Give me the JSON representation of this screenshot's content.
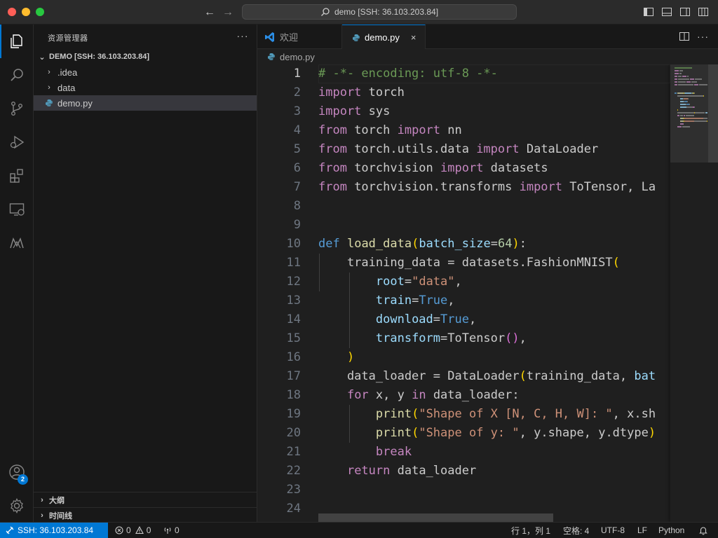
{
  "window": {
    "title": "demo [SSH: 36.103.203.84]"
  },
  "sidebar": {
    "title": "资源管理器",
    "more": "···",
    "root": "DEMO [SSH: 36.103.203.84]",
    "items": [
      {
        "label": ".idea",
        "type": "folder"
      },
      {
        "label": "data",
        "type": "folder"
      },
      {
        "label": "demo.py",
        "type": "file",
        "selected": true
      }
    ],
    "outline_label": "大纲",
    "timeline_label": "时间线"
  },
  "activity": {
    "accounts_badge": "2"
  },
  "tabs": [
    {
      "label": "欢迎",
      "active": false
    },
    {
      "label": "demo.py",
      "active": true,
      "close": "×"
    }
  ],
  "breadcrumb": {
    "file": "demo.py"
  },
  "editor": {
    "line_numbers": [
      "1",
      "2",
      "3",
      "4",
      "5",
      "6",
      "7",
      "8",
      "9",
      "10",
      "11",
      "12",
      "13",
      "14",
      "15",
      "16",
      "17",
      "18",
      "19",
      "20",
      "21",
      "22",
      "23",
      "24"
    ],
    "current_line": 1,
    "lines": [
      [
        [
          "c-comment",
          "# -*- encoding: utf-8 -*-"
        ]
      ],
      [
        [
          "c-kw",
          "import"
        ],
        [
          "c-plain",
          " torch"
        ]
      ],
      [
        [
          "c-kw",
          "import"
        ],
        [
          "c-plain",
          " sys"
        ]
      ],
      [
        [
          "c-kw",
          "from"
        ],
        [
          "c-plain",
          " torch "
        ],
        [
          "c-kw",
          "import"
        ],
        [
          "c-plain",
          " nn"
        ]
      ],
      [
        [
          "c-kw",
          "from"
        ],
        [
          "c-plain",
          " torch.utils.data "
        ],
        [
          "c-kw",
          "import"
        ],
        [
          "c-plain",
          " DataLoader"
        ]
      ],
      [
        [
          "c-kw",
          "from"
        ],
        [
          "c-plain",
          " torchvision "
        ],
        [
          "c-kw",
          "import"
        ],
        [
          "c-plain",
          " datasets"
        ]
      ],
      [
        [
          "c-kw",
          "from"
        ],
        [
          "c-plain",
          " torchvision.transforms "
        ],
        [
          "c-kw",
          "import"
        ],
        [
          "c-plain",
          " ToTensor, La"
        ]
      ],
      [],
      [],
      [
        [
          "c-def",
          "def"
        ],
        [
          "c-plain",
          " "
        ],
        [
          "c-fn",
          "load_data"
        ],
        [
          "c-b1",
          "("
        ],
        [
          "c-param",
          "batch_size"
        ],
        [
          "c-plain",
          "="
        ],
        [
          "c-num",
          "64"
        ],
        [
          "c-b1",
          ")"
        ],
        [
          "c-plain",
          ":"
        ]
      ],
      [
        [
          "c-plain",
          "    training_data = datasets.FashionMNIST"
        ],
        [
          "c-b1",
          "("
        ]
      ],
      [
        [
          "c-plain",
          "        "
        ],
        [
          "c-param",
          "root"
        ],
        [
          "c-plain",
          "="
        ],
        [
          "c-str",
          "\"data\""
        ],
        [
          "c-plain",
          ","
        ]
      ],
      [
        [
          "c-plain",
          "        "
        ],
        [
          "c-param",
          "train"
        ],
        [
          "c-plain",
          "="
        ],
        [
          "c-const",
          "True"
        ],
        [
          "c-plain",
          ","
        ]
      ],
      [
        [
          "c-plain",
          "        "
        ],
        [
          "c-param",
          "download"
        ],
        [
          "c-plain",
          "="
        ],
        [
          "c-const",
          "True"
        ],
        [
          "c-plain",
          ","
        ]
      ],
      [
        [
          "c-plain",
          "        "
        ],
        [
          "c-param",
          "transform"
        ],
        [
          "c-plain",
          "=ToTensor"
        ],
        [
          "c-b2",
          "()"
        ],
        [
          "c-plain",
          ","
        ]
      ],
      [
        [
          "c-plain",
          "    "
        ],
        [
          "c-b1",
          ")"
        ]
      ],
      [
        [
          "c-plain",
          "    data_loader = DataLoader"
        ],
        [
          "c-b1",
          "("
        ],
        [
          "c-plain",
          "training_data, "
        ],
        [
          "c-param",
          "bat"
        ]
      ],
      [
        [
          "c-plain",
          "    "
        ],
        [
          "c-kw",
          "for"
        ],
        [
          "c-plain",
          " x, y "
        ],
        [
          "c-kw",
          "in"
        ],
        [
          "c-plain",
          " data_loader:"
        ]
      ],
      [
        [
          "c-plain",
          "        "
        ],
        [
          "c-fn",
          "print"
        ],
        [
          "c-b1",
          "("
        ],
        [
          "c-str",
          "\"Shape of X [N, C, H, W]: \""
        ],
        [
          "c-plain",
          ", x.sh"
        ]
      ],
      [
        [
          "c-plain",
          "        "
        ],
        [
          "c-fn",
          "print"
        ],
        [
          "c-b1",
          "("
        ],
        [
          "c-str",
          "\"Shape of y: \""
        ],
        [
          "c-plain",
          ", y.shape, y.dtype"
        ],
        [
          "c-b1",
          ")"
        ]
      ],
      [
        [
          "c-plain",
          "        "
        ],
        [
          "c-kw",
          "break"
        ]
      ],
      [
        [
          "c-plain",
          "    "
        ],
        [
          "c-kw",
          "return"
        ],
        [
          "c-plain",
          " data_loader"
        ]
      ],
      [],
      []
    ]
  },
  "status": {
    "remote": "SSH: 36.103.203.84",
    "errors": "0",
    "warnings": "0",
    "ports": "0",
    "position": "行 1，列 1",
    "spaces": "空格: 4",
    "encoding": "UTF-8",
    "eol": "LF",
    "language": "Python"
  },
  "colors": {
    "accent": "#0078d4",
    "editor_bg": "#1f1f1f",
    "sidebar_bg": "#181818"
  }
}
